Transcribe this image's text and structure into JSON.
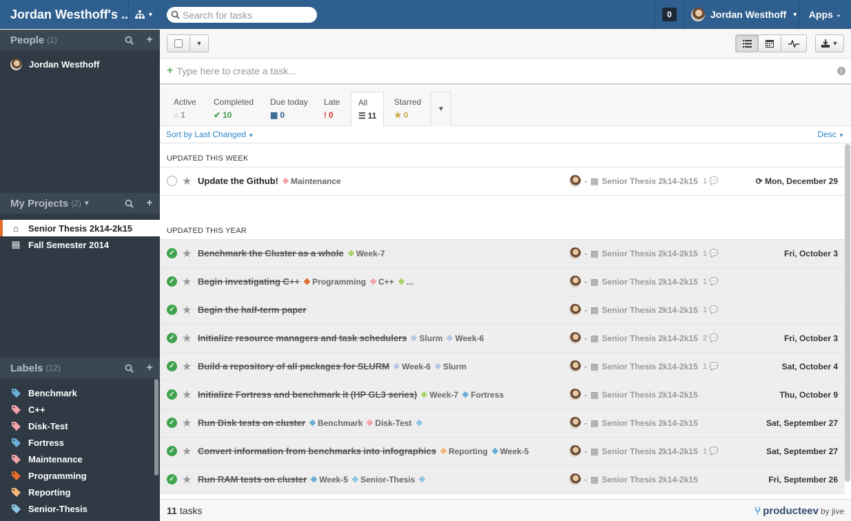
{
  "topbar": {
    "workspace_title": "Jordan Westhoff's ...",
    "search_placeholder": "Search for tasks",
    "notification_count": "0",
    "user_name": "Jordan Westhoff",
    "apps_label": "Apps"
  },
  "sidebar": {
    "people": {
      "title": "People",
      "count": "(1)",
      "items": [
        {
          "label": "Jordan Westhoff"
        }
      ]
    },
    "projects": {
      "title": "My Projects",
      "count": "(2)",
      "items": [
        {
          "label": "Senior Thesis 2k14-2k15",
          "icon": "home-icon",
          "active": true
        },
        {
          "label": "Fall Semester 2014",
          "icon": "book-icon",
          "active": false
        }
      ]
    },
    "labels": {
      "title": "Labels",
      "count": "(12)",
      "items": [
        {
          "label": "Benchmark",
          "color": "#6aaed6"
        },
        {
          "label": "C++",
          "color": "#f2a3a8"
        },
        {
          "label": "Disk-Test",
          "color": "#f2a3a8"
        },
        {
          "label": "Fortress",
          "color": "#6aaed6"
        },
        {
          "label": "Maintenance",
          "color": "#f2a3a8"
        },
        {
          "label": "Programming",
          "color": "#e36b2b"
        },
        {
          "label": "Reporting",
          "color": "#f4b679"
        },
        {
          "label": "Senior-Thesis",
          "color": "#8ec5e3"
        }
      ]
    }
  },
  "create_placeholder": "Type here to create a task...",
  "filters": [
    {
      "label": "Active",
      "value": "1",
      "icon": "circle-icon",
      "color": "#999999"
    },
    {
      "label": "Completed",
      "value": "10",
      "icon": "check-icon",
      "color": "#3fa34d"
    },
    {
      "label": "Due today",
      "value": "0",
      "icon": "calendar-icon",
      "color": "#2e5f8e"
    },
    {
      "label": "Late",
      "value": "0",
      "icon": "exclamation-icon",
      "color": "#d9322e"
    },
    {
      "label": "All",
      "value": "11",
      "icon": "list-icon",
      "color": "#333333"
    },
    {
      "label": "Starred",
      "value": "0",
      "icon": "star-icon",
      "color": "#c9a94a"
    }
  ],
  "sort": {
    "label": "Sort by Last Changed",
    "order": "Desc"
  },
  "groups": {
    "week": "UPDATED THIS WEEK",
    "year": "UPDATED THIS YEAR"
  },
  "project_name": "Senior Thesis 2k14-2k15",
  "tasks_week": [
    {
      "title": "Update the Github!",
      "done": false,
      "tags": [
        {
          "name": "Maintenance",
          "color": "#f2a3a8"
        }
      ],
      "comments": "1",
      "date": "Mon, December 29",
      "repeat": true
    }
  ],
  "tasks_year": [
    {
      "title": "Benchmark the Cluster as a whole",
      "done": true,
      "tags": [
        {
          "name": "Week-7",
          "color": "#a9d36b"
        }
      ],
      "comments": "1",
      "date": "Fri, October 3"
    },
    {
      "title": "Begin investigating C++",
      "done": true,
      "tags": [
        {
          "name": "Programming",
          "color": "#e36b2b"
        },
        {
          "name": "C++",
          "color": "#f2a3a8"
        },
        {
          "name": "...",
          "color": "#a9d36b"
        }
      ],
      "comments": "1",
      "date": ""
    },
    {
      "title": "Begin the half-term paper",
      "done": true,
      "tags": [],
      "comments": "1",
      "date": ""
    },
    {
      "title": "Initialize resource managers and task schedulers",
      "done": true,
      "tags": [
        {
          "name": "Slurm",
          "color": "#b8c7e6"
        },
        {
          "name": "Week-6",
          "color": "#b8c7e6"
        }
      ],
      "comments": "2",
      "date": "Fri, October 3"
    },
    {
      "title": "Build a repository of all packages for SLURM",
      "done": true,
      "tags": [
        {
          "name": "Week-6",
          "color": "#b8c7e6"
        },
        {
          "name": "Slurm",
          "color": "#b8c7e6"
        }
      ],
      "comments": "1",
      "date": "Sat, October 4"
    },
    {
      "title": "Initialize Fortress and benchmark it (HP GL3 series)",
      "done": true,
      "tags": [
        {
          "name": "Week-7",
          "color": "#a9d36b"
        },
        {
          "name": "Fortress",
          "color": "#6aaed6"
        }
      ],
      "comments": "",
      "date": "Thu, October 9"
    },
    {
      "title": "Run Disk tests on cluster",
      "done": true,
      "tags": [
        {
          "name": "Benchmark",
          "color": "#6aaed6"
        },
        {
          "name": "Disk-Test",
          "color": "#f2a3a8"
        },
        {
          "name": "",
          "color": "#8ec5e3"
        }
      ],
      "comments": "",
      "date": "Sat, September 27"
    },
    {
      "title": "Convert information from benchmarks into infographics",
      "done": true,
      "tags": [
        {
          "name": "Reporting",
          "color": "#f4b679"
        },
        {
          "name": "Week-5",
          "color": "#6aaed6"
        }
      ],
      "comments": "1",
      "date": "Sat, September 27"
    },
    {
      "title": "Run RAM tests on cluster",
      "done": true,
      "tags": [
        {
          "name": "Week-5",
          "color": "#6aaed6"
        },
        {
          "name": "Senior-Thesis",
          "color": "#8ec5e3"
        },
        {
          "name": "",
          "color": "#8ec5e3"
        }
      ],
      "comments": "",
      "date": "Fri, September 26"
    }
  ],
  "footer": {
    "count": "11",
    "suffix": "tasks",
    "brand": "producteev",
    "brand_by": "by jive"
  }
}
